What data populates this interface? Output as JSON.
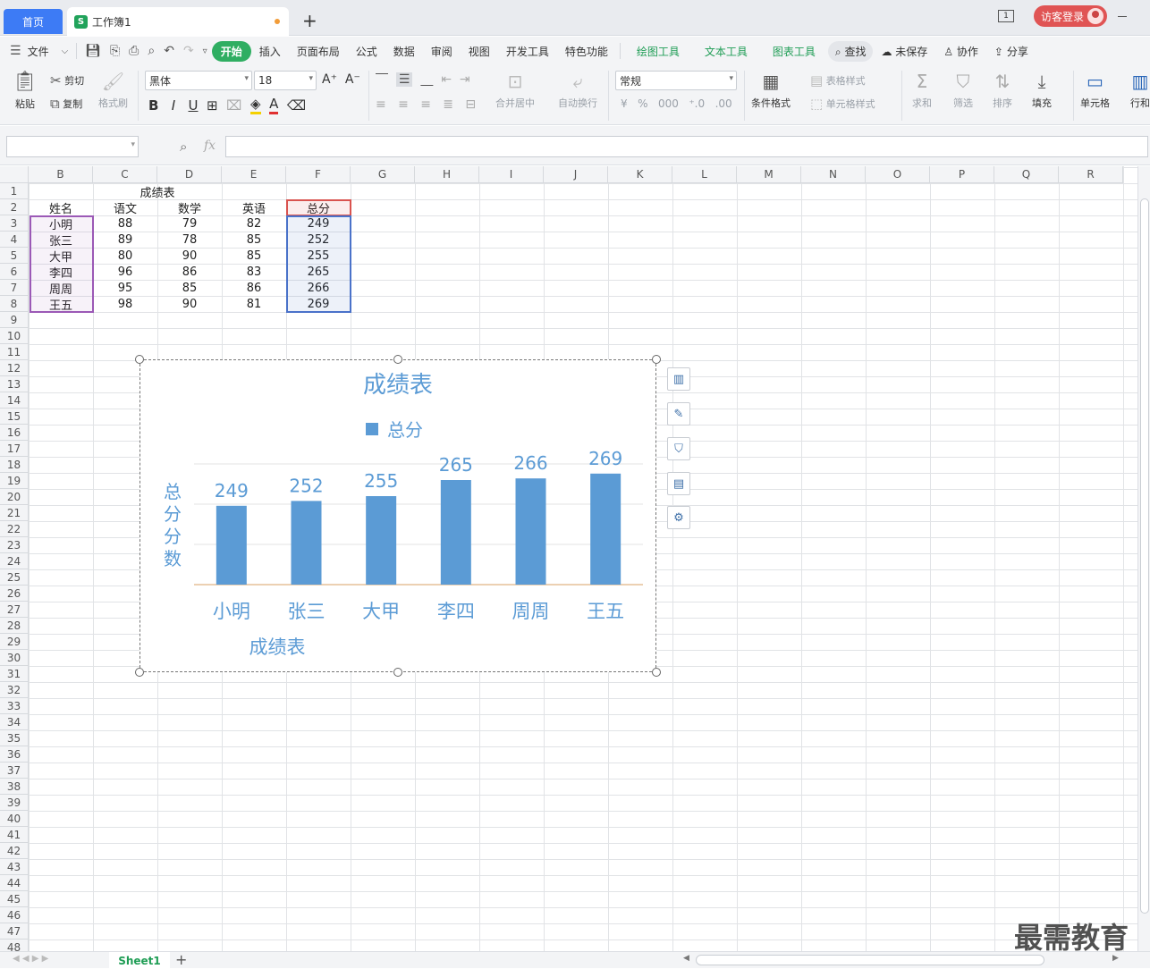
{
  "titlebar": {
    "home_tab": "首页",
    "doc_tab": "工作簿1",
    "doc_icon": "S",
    "new_tab": "+",
    "login": "访客登录"
  },
  "menubar": {
    "file": "文件",
    "tabs": [
      "开始",
      "插入",
      "页面布局",
      "公式",
      "数据",
      "审阅",
      "视图",
      "开发工具",
      "特色功能"
    ],
    "context_tabs": [
      "绘图工具",
      "文本工具",
      "图表工具"
    ],
    "search": "查找",
    "unsaved": "未保存",
    "collab": "协作",
    "share": "分享"
  },
  "ribbon": {
    "paste": "粘贴",
    "cut": "剪切",
    "copy": "复制",
    "format_painter": "格式刷",
    "font_name": "黑体",
    "font_size": "18",
    "merge_center": "合并居中",
    "wrap_text": "自动换行",
    "number_format": "常规",
    "cond_format": "条件格式",
    "table_style": "表格样式",
    "cell_style": "单元格样式",
    "sum": "求和",
    "filter": "筛选",
    "sort": "排序",
    "fill": "填充",
    "cell": "单元格",
    "row_col": "行和"
  },
  "formula": {
    "fx": "fx"
  },
  "grid": {
    "columns": [
      "B",
      "C",
      "D",
      "E",
      "F",
      "G",
      "H",
      "I",
      "J",
      "K",
      "L",
      "M",
      "N",
      "O",
      "P",
      "Q",
      "R"
    ],
    "rows": [
      "1",
      "2",
      "3",
      "4",
      "5",
      "6",
      "7",
      "8",
      "9",
      "10",
      "11",
      "12",
      "13",
      "14",
      "15",
      "16",
      "17",
      "18",
      "19",
      "20",
      "21",
      "22",
      "23",
      "24",
      "25",
      "26",
      "27",
      "28",
      "29",
      "30",
      "31",
      "32",
      "33",
      "34",
      "35",
      "36",
      "37",
      "38",
      "39",
      "40",
      "41",
      "42",
      "43",
      "44",
      "45",
      "46",
      "47",
      "48"
    ],
    "table_title": "成绩表",
    "headers": [
      "姓名",
      "语文",
      "数学",
      "英语",
      "总分"
    ],
    "data": [
      [
        "小明",
        "88",
        "79",
        "82",
        "249"
      ],
      [
        "张三",
        "89",
        "78",
        "85",
        "252"
      ],
      [
        "大甲",
        "80",
        "90",
        "85",
        "255"
      ],
      [
        "李四",
        "96",
        "86",
        "83",
        "265"
      ],
      [
        "周周",
        "95",
        "85",
        "86",
        "266"
      ],
      [
        "王五",
        "98",
        "90",
        "81",
        "269"
      ]
    ]
  },
  "chart_data": {
    "type": "bar",
    "title": "成绩表",
    "categories": [
      "小明",
      "张三",
      "大甲",
      "李四",
      "周周",
      "王五"
    ],
    "series": [
      {
        "name": "总分",
        "values": [
          249,
          252,
          255,
          265,
          266,
          269
        ]
      }
    ],
    "xlabel": "成绩表",
    "ylabel": "总分分数",
    "ylim": [
      200,
      275
    ],
    "grid": true,
    "legend": "top",
    "bar_color": "#5b9bd5",
    "text_color": "#5b9bd5"
  },
  "sheets": {
    "active": "Sheet1",
    "add": "+"
  },
  "watermark": "最需教育"
}
